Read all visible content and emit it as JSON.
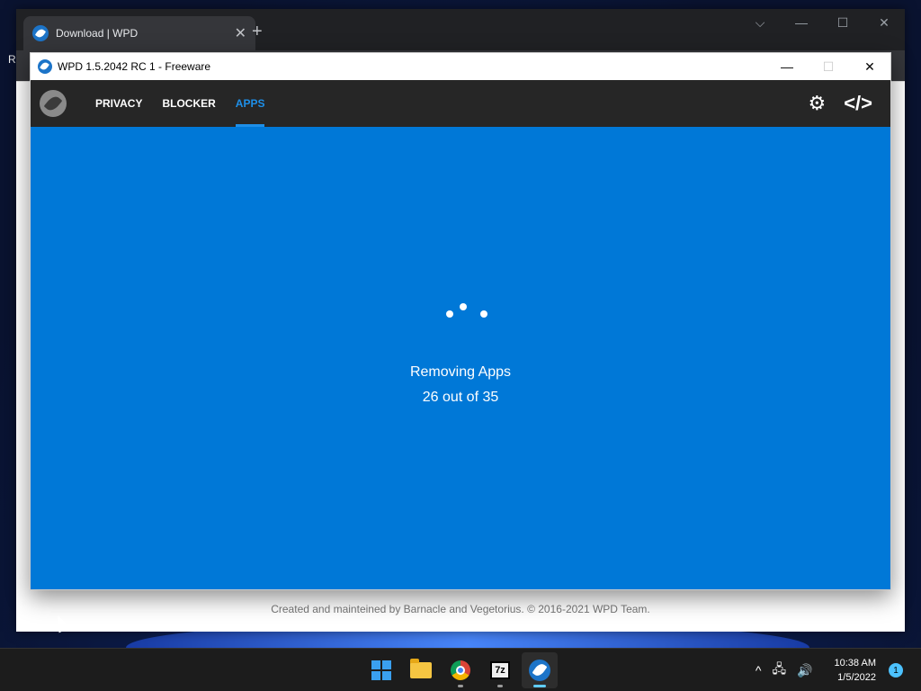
{
  "desktop": {
    "fragment_text": "R"
  },
  "browser": {
    "tab_title": "Download | WPD",
    "tab_close": "✕",
    "new_tab": "+",
    "controls": {
      "menu": "⌵",
      "minimize": "—",
      "maximize": "☐",
      "close": "✕"
    },
    "footer_text": "Created and mainteined by Barnacle and Vegetorius. © 2016-2021 WPD Team."
  },
  "app": {
    "title": "WPD 1.5.2042 RC 1 - Freeware",
    "controls": {
      "minimize": "—",
      "maximize": "☐",
      "close": "✕"
    },
    "nav": {
      "items": [
        {
          "label": "PRIVACY",
          "active": false
        },
        {
          "label": "BLOCKER",
          "active": false
        },
        {
          "label": "APPS",
          "active": true
        }
      ],
      "settings_icon": "⚙",
      "code_icon": "</>"
    },
    "status": {
      "title": "Removing Apps",
      "count": "26 out of 35",
      "done": 26,
      "total": 35
    },
    "accent_color": "#0078d7"
  },
  "taskbar": {
    "apps": [
      "start-icon",
      "file-explorer-icon",
      "chrome-icon",
      "7zip-icon",
      "wpd-icon"
    ],
    "sevenzip_label": "7z",
    "tray": {
      "chevron": "^",
      "network": "🖧",
      "volume": "🔊"
    },
    "time": "10:38 AM",
    "date": "1/5/2022",
    "notification_count": "1"
  }
}
